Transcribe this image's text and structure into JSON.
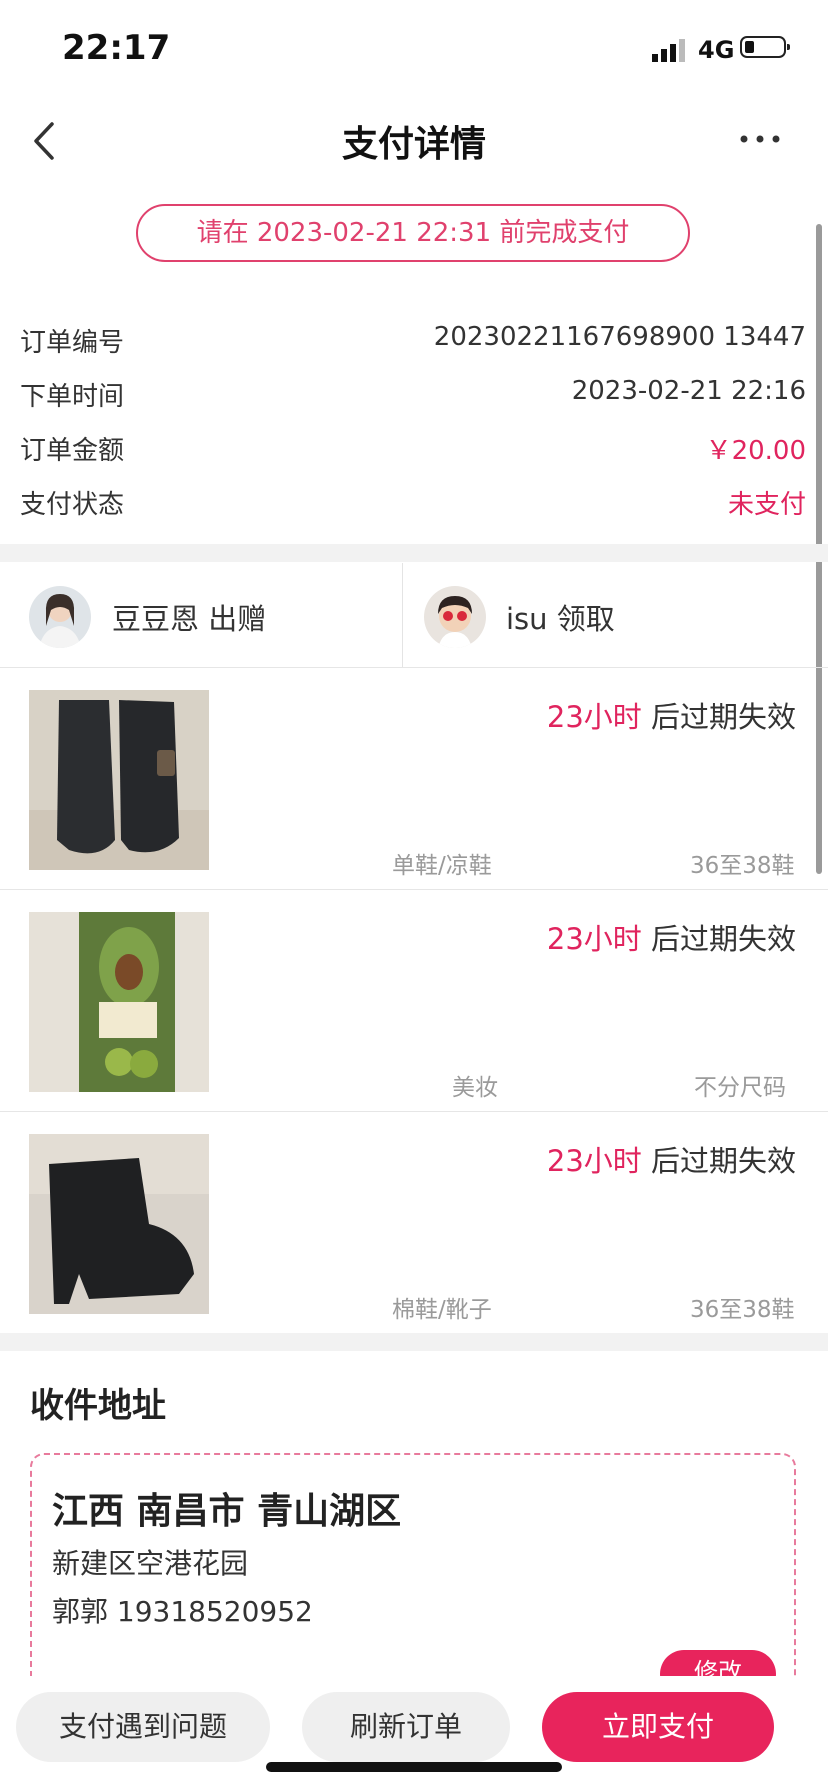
{
  "status_bar": {
    "time": "22:17",
    "network": "4G"
  },
  "nav": {
    "title": "支付详情"
  },
  "deadline_notice": "请在 2023-02-21 22:31 前完成支付",
  "order": {
    "rows": [
      {
        "label": "订单编号",
        "value": "20230221167698900 13447"
      },
      {
        "label": "下单时间",
        "value": "2023-02-21 22:16"
      },
      {
        "label": "订单金额",
        "value": "￥20.00"
      },
      {
        "label": "支付状态",
        "value": "未支付"
      }
    ]
  },
  "people": {
    "giver": {
      "name": "豆豆恩 出赠"
    },
    "receiver": {
      "name": "isu 领取"
    }
  },
  "items": [
    {
      "expiry_time": "23小时",
      "expiry_suffix": " 后过期失效",
      "category": "单鞋/凉鞋",
      "size": "36至38鞋"
    },
    {
      "expiry_time": "23小时",
      "expiry_suffix": " 后过期失效",
      "category": "美妆",
      "size": "不分尺码"
    },
    {
      "expiry_time": "23小时",
      "expiry_suffix": " 后过期失效",
      "category": "棉鞋/靴子",
      "size": "36至38鞋"
    }
  ],
  "address": {
    "title": "收件地址",
    "region": "江西 南昌市 青山湖区",
    "detail": "新建区空港花园",
    "contact": "郭郭 19318520952",
    "edit_label": "修改"
  },
  "actions": {
    "problem_label": "支付遇到问题",
    "refresh_label": "刷新订单",
    "pay_label": "立即支付"
  },
  "colors": {
    "accent": "#e8245c",
    "text": "#333333",
    "muted": "#9a9a9a"
  }
}
